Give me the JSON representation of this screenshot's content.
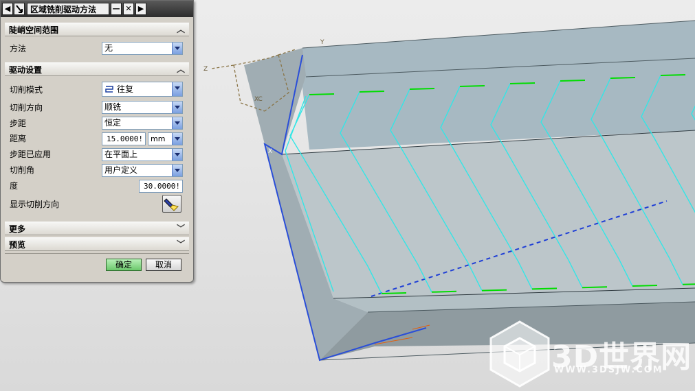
{
  "dialog": {
    "title": "区域铣削驱动方法",
    "buttons": {
      "back": "◀",
      "minimize": "—",
      "close": "✕",
      "forward": "▶"
    }
  },
  "sections": {
    "steep": {
      "label": "陡峭空间范围",
      "chevron_icon": "chevron-up-icon"
    },
    "drive": {
      "label": "驱动设置",
      "chevron_icon": "chevron-up-icon"
    },
    "more": {
      "label": "更多",
      "chevron_icon": "chevron-down-icon"
    },
    "preview": {
      "label": "预览",
      "chevron_icon": "chevron-down-icon"
    }
  },
  "fields": {
    "method": {
      "label": "方法",
      "value": "无"
    },
    "cut_pattern": {
      "label": "切削模式",
      "value": "往复",
      "icon": "zigzag-pattern-icon"
    },
    "cut_direction": {
      "label": "切削方向",
      "value": "顺铣"
    },
    "stepover": {
      "label": "步距",
      "value": "恒定"
    },
    "distance": {
      "label": "距离",
      "value": "15.0000!",
      "unit": "mm"
    },
    "stepover_applied": {
      "label": "步距已应用",
      "value": "在平面上"
    },
    "cut_angle": {
      "label": "切削角",
      "value": "用户定义"
    },
    "degree": {
      "label": "度",
      "value": "30.0000!"
    },
    "show_direction": {
      "label": "显示切削方向",
      "icon": "flashlight-icon"
    }
  },
  "actions": {
    "ok": "确定",
    "cancel": "取消"
  },
  "viewport": {
    "axis_labels": {
      "xc": "XC",
      "y": "Y",
      "z": "Z",
      "x": "X"
    }
  },
  "watermark": {
    "text": "3D世界网",
    "url": "WWW.3DSJW.COM"
  },
  "colors": {
    "toolpath": "#33e6e6",
    "engage": "#00dd00",
    "model_top": "#9fb3bd",
    "model_side": "#a8b7be",
    "edge_blue": "#2a4ed8",
    "ok_button": "#7ed27e"
  }
}
